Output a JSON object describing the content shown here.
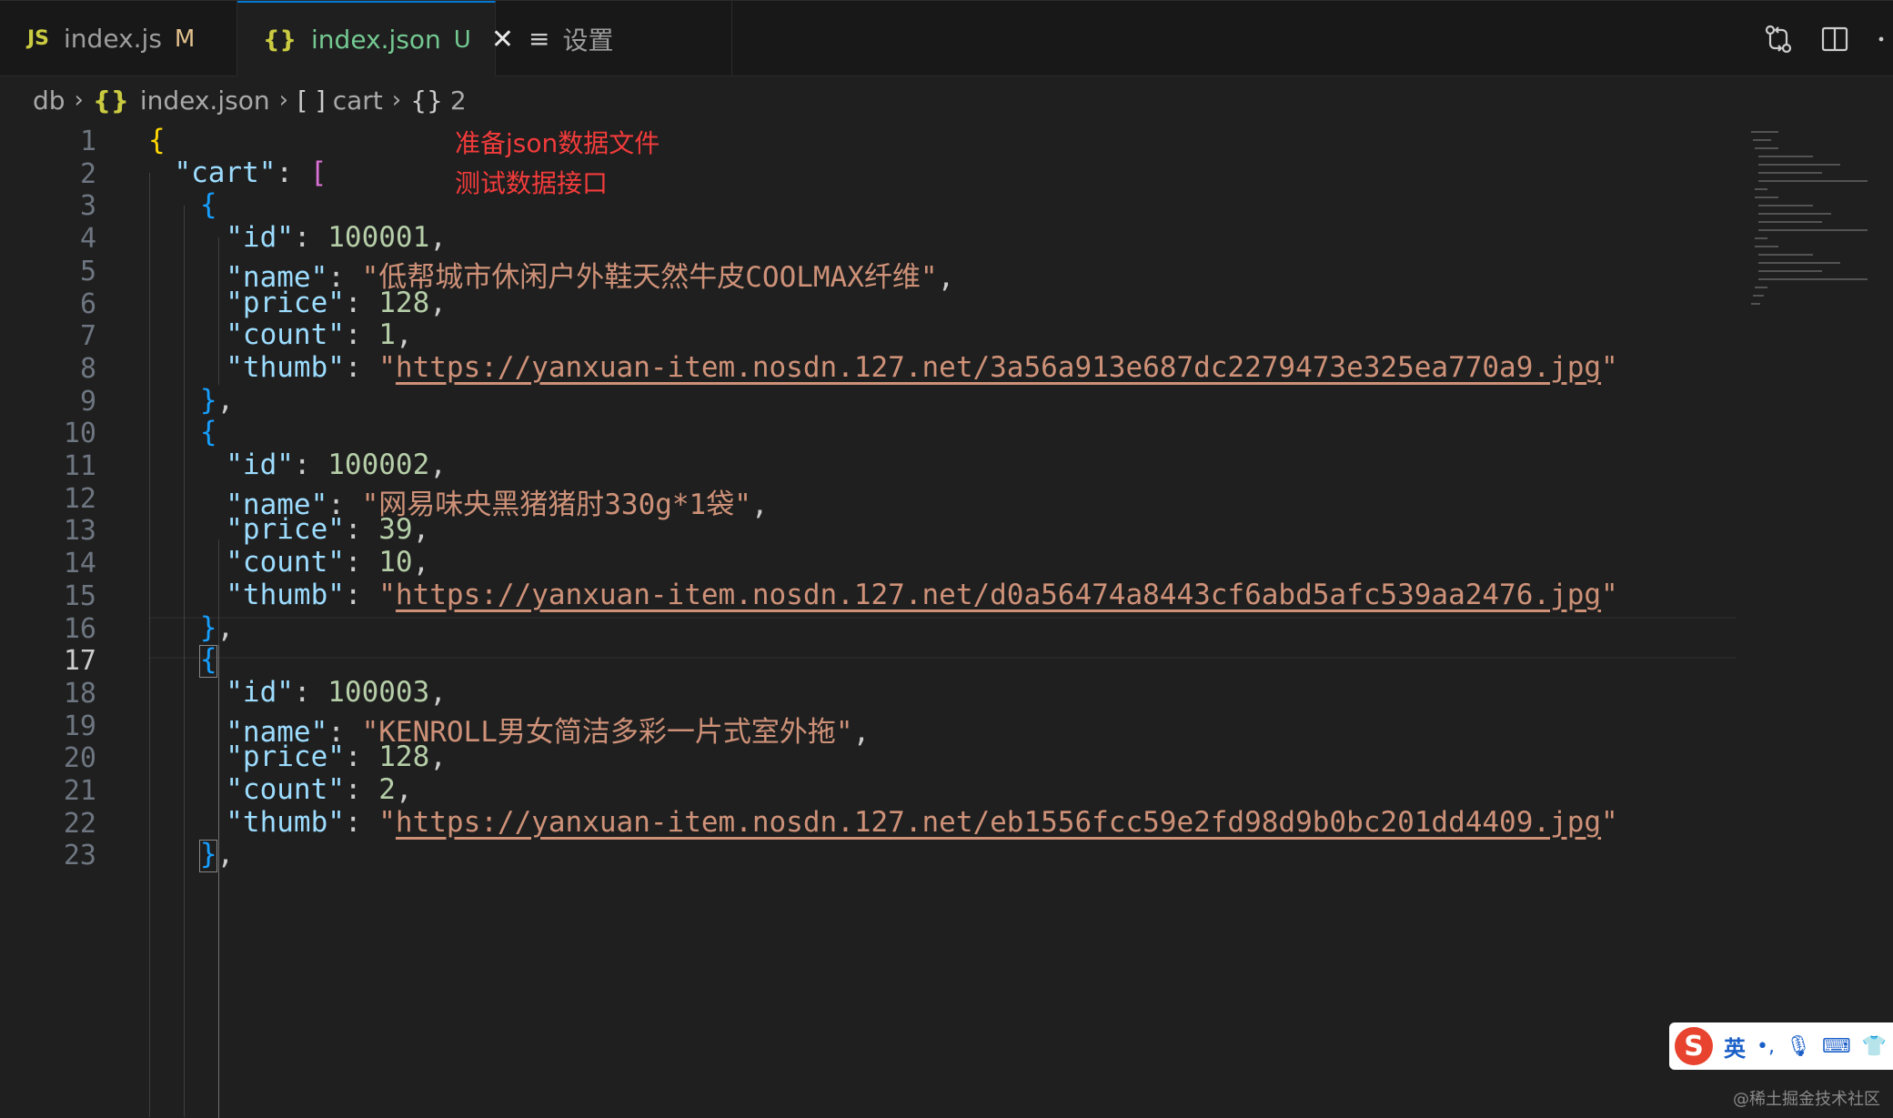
{
  "tabs": [
    {
      "badge": "JS",
      "label": "index.js",
      "status": "M"
    },
    {
      "badge": "{}",
      "label": "index.json",
      "status": "U",
      "close": "✕"
    },
    {
      "badge": "≡",
      "label": "设置"
    }
  ],
  "breadcrumb": {
    "root": "db",
    "file_badge": "{}",
    "file": "index.json",
    "array_sym": "[ ]",
    "array": "cart",
    "object_sym": "{}",
    "object": "2"
  },
  "annotation": {
    "line1": "准备json数据文件",
    "line2": "测试数据接口"
  },
  "editor": {
    "current_line": 17,
    "line_numbers": [
      "1",
      "2",
      "3",
      "4",
      "5",
      "6",
      "7",
      "8",
      "9",
      "10",
      "11",
      "12",
      "13",
      "14",
      "15",
      "16",
      "17",
      "18",
      "19",
      "20",
      "21",
      "22",
      "23"
    ],
    "items": [
      {
        "id": "100001",
        "name": "\"低帮城市休闲户外鞋天然牛皮COOLMAX纤维\"",
        "price": "128",
        "count": "1",
        "thumb": "https://yanxuan-item.nosdn.127.net/3a56a913e687dc2279473e325ea770a9.jpg"
      },
      {
        "id": "100002",
        "name": "\"网易味央黑猪猪肘330g*1袋\"",
        "price": "39",
        "count": "10",
        "thumb": "https://yanxuan-item.nosdn.127.net/d0a56474a8443cf6abd5afc539aa2476.jpg"
      },
      {
        "id": "100003",
        "name": "\"KENROLL男女简洁多彩一片式室外拖\"",
        "price": "128",
        "count": "2",
        "thumb": "https://yanxuan-item.nosdn.127.net/eb1556fcc59e2fd98d9b0bc201dd4409.jpg"
      }
    ],
    "keys": {
      "root": "\"cart\"",
      "id": "\"id\"",
      "name": "\"name\"",
      "price": "\"price\"",
      "count": "\"count\"",
      "thumb": "\"thumb\""
    }
  },
  "ime": {
    "logo": "S",
    "lang": "英",
    "punct": "•,",
    "mic": "🎙",
    "keyboard": "⌨",
    "skin": "👕"
  },
  "watermark": "@稀土掘金技术社区",
  "colors": {
    "key": "#9cdcfe",
    "string": "#ce9178",
    "number": "#b5cea8",
    "bracket1": "#ffd700",
    "bracket2": "#da70d6",
    "bracket3": "#179fff",
    "annotation": "#f23b3b"
  }
}
